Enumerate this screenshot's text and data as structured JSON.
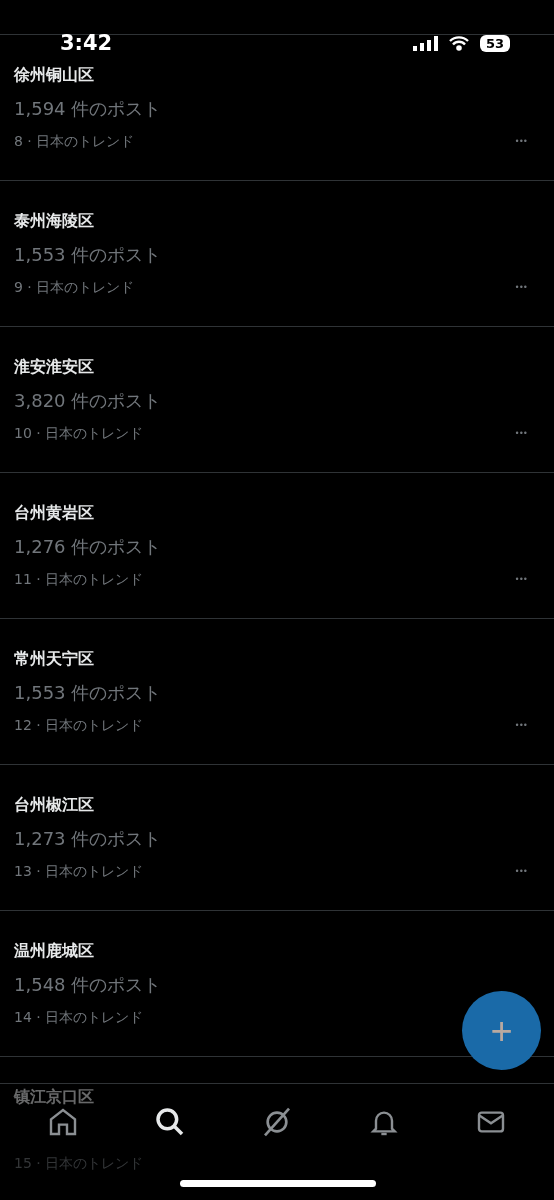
{
  "status_bar": {
    "time": "3:42",
    "battery": "53"
  },
  "trends": [
    {
      "title": "徐州铜山区",
      "count": "1,594 件のポスト",
      "meta": "8 · 日本のトレンド",
      "more": "•••"
    },
    {
      "title": "泰州海陵区",
      "count": "1,553 件のポスト",
      "meta": "9 · 日本のトレンド",
      "more": "•••"
    },
    {
      "title": "淮安淮安区",
      "count": "3,820 件のポスト",
      "meta": "10 · 日本のトレンド",
      "more": "•••"
    },
    {
      "title": "台州黄岩区",
      "count": "1,276 件のポスト",
      "meta": "11 · 日本のトレンド",
      "more": "•••"
    },
    {
      "title": "常州天宁区",
      "count": "1,553 件のポスト",
      "meta": "12 · 日本のトレンド",
      "more": "•••"
    },
    {
      "title": "台州椒江区",
      "count": "1,273 件のポスト",
      "meta": "13 · 日本のトレンド",
      "more": "•••"
    },
    {
      "title": "温州鹿城区",
      "count": "1,548 件のポスト",
      "meta": "14 · 日本のトレンド"
    },
    {
      "title": "镇江京口区",
      "meta": "15 · 日本のトレンド"
    }
  ],
  "fab": {
    "label": "+"
  },
  "tab_bar": [
    {
      "kind": "home",
      "selected": false
    },
    {
      "kind": "search",
      "selected": true
    },
    {
      "kind": "grok",
      "selected": false
    },
    {
      "kind": "bell",
      "selected": false
    },
    {
      "kind": "mail",
      "selected": false
    }
  ]
}
